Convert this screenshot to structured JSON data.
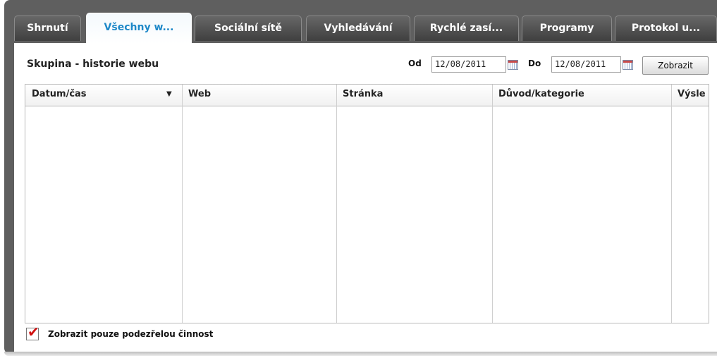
{
  "tabs": [
    {
      "label": "Shrnutí"
    },
    {
      "label": "Všechny w...",
      "active": true
    },
    {
      "label": "Sociální sítě"
    },
    {
      "label": "Vyhledávání"
    },
    {
      "label": "Rychlé zasí..."
    },
    {
      "label": "Programy"
    },
    {
      "label": "Protokol u..."
    }
  ],
  "header": {
    "title": "Skupina - historie webu",
    "from_label": "Od",
    "from_value": "12/08/2011",
    "to_label": "Do",
    "to_value": "12/08/2011",
    "show_button": "Zobrazit"
  },
  "table": {
    "columns": [
      "Datum/čas",
      "Web",
      "Stránka",
      "Důvod/kategorie",
      "Výsle"
    ],
    "sort_indicator": "▼",
    "rows": []
  },
  "filter": {
    "label": "Zobrazit pouze podezřelou činnost",
    "checked": true,
    "check_color": "#d01010"
  },
  "colors": {
    "accent": "#1e88c8",
    "frame": "#5f5f5f"
  }
}
